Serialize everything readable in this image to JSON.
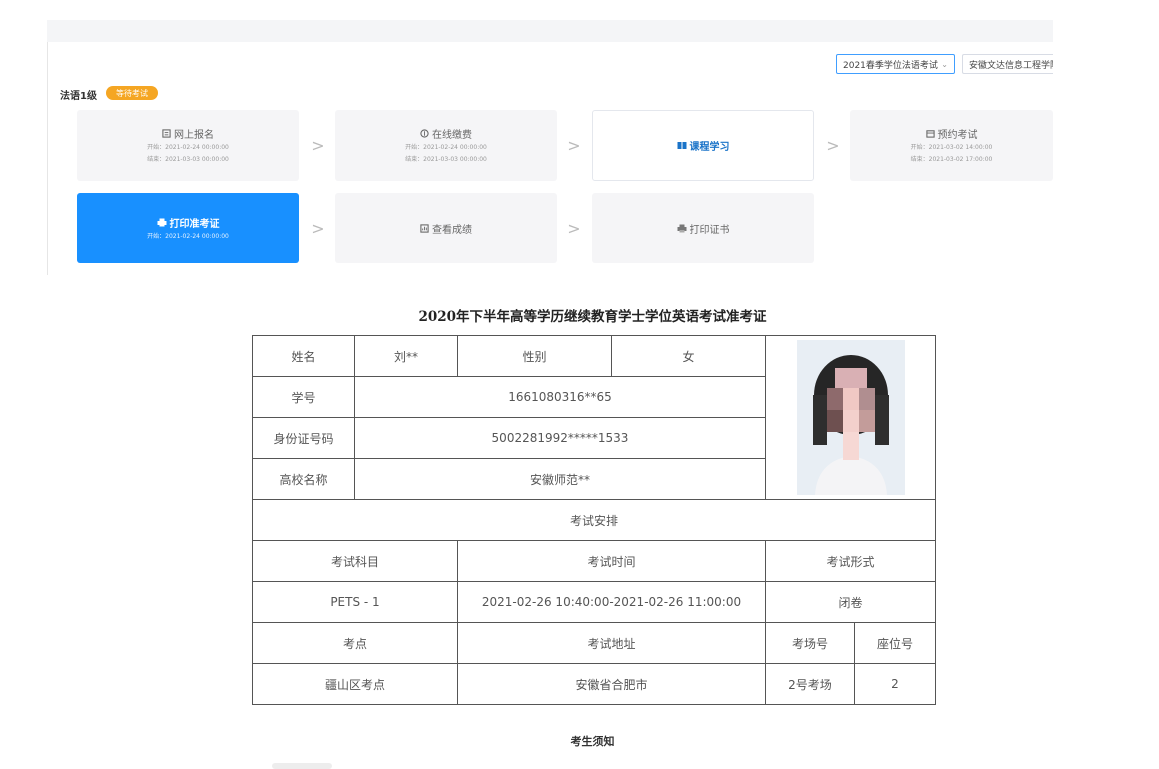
{
  "filters": {
    "exam_select": "2021春季学位法语考试",
    "school_select": "安徽文达信息工程学院"
  },
  "level": {
    "name": "法语1级",
    "badge": "等待考试"
  },
  "steps": [
    {
      "title": "网上报名",
      "start": "开始：2021-02-24 00:00:00",
      "end": "结束：2021-03-03 00:00:00",
      "icon": "form-icon"
    },
    {
      "title": "在线缴费",
      "start": "开始：2021-02-24 00:00:00",
      "end": "结束：2021-03-03 00:00:00",
      "icon": "payment-icon"
    },
    {
      "title": "课程学习",
      "icon": "book-icon"
    },
    {
      "title": "预约考试",
      "start": "开始：2021-03-02 14:00:00",
      "end": "结束：2021-03-02 17:00:00",
      "icon": "calendar-icon"
    },
    {
      "title": "打印准考证",
      "start": "开始：2021-02-24 00:00:00",
      "icon": "printer-icon"
    },
    {
      "title": "查看成绩",
      "icon": "score-icon"
    },
    {
      "title": "打印证书",
      "icon": "printer-icon"
    }
  ],
  "ticket": {
    "title": "2020年下半年高等学历继续教育学士学位英语考试准考证",
    "labels": {
      "name": "姓名",
      "gender": "性别",
      "student_id": "学号",
      "id_number": "身份证号码",
      "school": "高校名称",
      "arrangement": "考试安排",
      "subject": "考试科目",
      "time": "考试时间",
      "format": "考试形式",
      "site": "考点",
      "address": "考试地址",
      "room": "考场号",
      "seat": "座位号"
    },
    "values": {
      "name": "刘**",
      "gender": "女",
      "student_id": "1661080316**65",
      "id_number": "5002281992*****1533",
      "school": "安徽师范**",
      "subject": "PETS - 1",
      "time": "2021-02-26 10:40:00-2021-02-26 11:00:00",
      "format": "闭卷",
      "site": "疆山区考点",
      "address": "安徽省合肥市",
      "room": "2号考场",
      "seat": "2"
    }
  },
  "notice_title": "考生须知"
}
